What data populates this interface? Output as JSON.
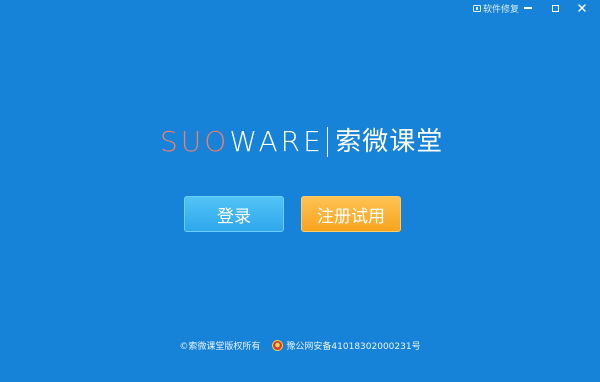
{
  "titlebar": {
    "repair_label": "软件修复",
    "icons": {
      "repair": "toolbox-icon",
      "minimize": "minimize-icon",
      "maximize": "maximize-icon",
      "close": "close-icon"
    }
  },
  "logo": {
    "latin_accent": "SUO",
    "latin_main": "WARE",
    "chinese": "索微课堂"
  },
  "actions": {
    "login_label": "登录",
    "register_label": "注册试用"
  },
  "footer": {
    "copyright": "©索微课堂版权所有",
    "icp": "豫公网安备41018302000231号",
    "icp_icon": "police-badge-icon"
  },
  "colors": {
    "background": "#1682d8",
    "logo_accent": "#ef7d6f",
    "login_button": "#3db3f0",
    "register_button": "#f9ab2c"
  }
}
